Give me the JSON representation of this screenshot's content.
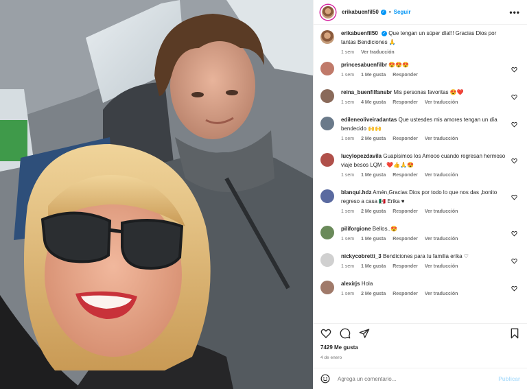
{
  "post": {
    "username": "erikabuenfil50",
    "follow_label": "Seguir",
    "more_label": "•••",
    "caption": {
      "username": "erikabuenfil50",
      "text": "Que tengan un súper día!!! Gracias Dios por tantas Bendiciones 🙏",
      "time": "1 sem",
      "translate_label": "Ver traducción"
    },
    "comments": [
      {
        "username": "princesabuenfilbr",
        "text": "😍😍😍",
        "time": "1 sem",
        "likes": "1 Me gusta",
        "reply": "Responder",
        "translate": ""
      },
      {
        "username": "reina_buenfilfansbr",
        "text": "Mis personas favoritas 😍❤️",
        "time": "1 sem",
        "likes": "4 Me gusta",
        "reply": "Responder",
        "translate": "Ver traducción"
      },
      {
        "username": "edileneoliveiradantas",
        "text": "Que ustesdes mis amores tengan un día bendecido 🙌🙌",
        "time": "1 sem",
        "likes": "2 Me gusta",
        "reply": "Responder",
        "translate": "Ver traducción"
      },
      {
        "username": "lucylopezdavila",
        "text": "Guapísimos los Amooo cuando regresan hermoso viaje besos LQM . ❤️👍🙏😍",
        "time": "1 sem",
        "likes": "1 Me gusta",
        "reply": "Responder",
        "translate": "Ver traducción"
      },
      {
        "username": "blanqui.hdz",
        "text": "Amén,Gracias Dios por todo lo que nos das ,bonito regreso a casa 🇲🇽 Erika ♥",
        "time": "1 sem",
        "likes": "2 Me gusta",
        "reply": "Responder",
        "translate": "Ver traducción"
      },
      {
        "username": "piliforgione",
        "text": "Bellos..😍",
        "time": "1 sem",
        "likes": "1 Me gusta",
        "reply": "Responder",
        "translate": "Ver traducción"
      },
      {
        "username": "nickycobretti_3",
        "text": "Bendiciones para tu familia erika ♡",
        "time": "1 sem",
        "likes": "1 Me gusta",
        "reply": "Responder",
        "translate": "Ver traducción"
      },
      {
        "username": "alexirjs",
        "text": "Hola",
        "time": "1 sem",
        "likes": "2 Me gusta",
        "reply": "Responder",
        "translate": "Ver traducción"
      }
    ],
    "likes_count": "7429 Me gusta",
    "date": "4 de enero",
    "comment_placeholder": "Agrega un comentario...",
    "publish_label": "Publicar"
  },
  "icons": [
    "heart-icon",
    "comment-icon",
    "share-icon",
    "bookmark-icon",
    "emoji-icon",
    "verified-icon",
    "more-icon"
  ],
  "colors": {
    "link_blue": "#0095f6",
    "publish_disabled": "#b2dffc",
    "meta_gray": "#737373",
    "text": "#262626"
  }
}
